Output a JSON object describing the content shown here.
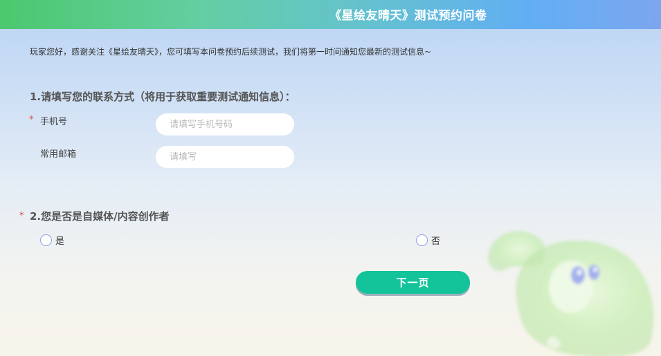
{
  "header": {
    "title": "《星绘友晴天》测试预约问卷"
  },
  "intro": "玩家您好，感谢关注《星绘友晴天》，您可填写本问卷预约后续测试，我们将第一时间通知您最新的测试信息~",
  "question1": {
    "title": "1.请填写您的联系方式（将用于获取重要测试通知信息）：",
    "phone": {
      "required_mark": "*",
      "label": "手机号",
      "value": "",
      "placeholder": "请填写手机号码"
    },
    "email": {
      "label": "常用邮箱",
      "value": "",
      "placeholder": "请填写"
    }
  },
  "question2": {
    "required_mark": "*",
    "title": "2.您是否是自媒体/内容创作者",
    "options": [
      {
        "label": "是",
        "selected": false
      },
      {
        "label": "否",
        "selected": false
      }
    ]
  },
  "next_button": {
    "label": "下一页"
  },
  "colors": {
    "accent": "#13c49b",
    "required": "#e04a4a",
    "header_start": "#4cc86e",
    "header_end": "#7ca6ee"
  }
}
